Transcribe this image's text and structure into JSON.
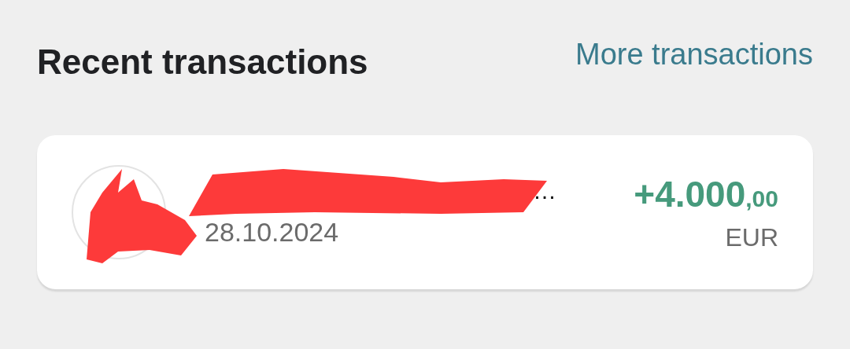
{
  "header": {
    "title": "Recent transactions",
    "link": "More transactions"
  },
  "transactions": [
    {
      "name": "…",
      "date": "28.10.2024",
      "amount_whole": "+4.000",
      "amount_fraction": ",00",
      "currency": "EUR",
      "redacted": true
    }
  ]
}
